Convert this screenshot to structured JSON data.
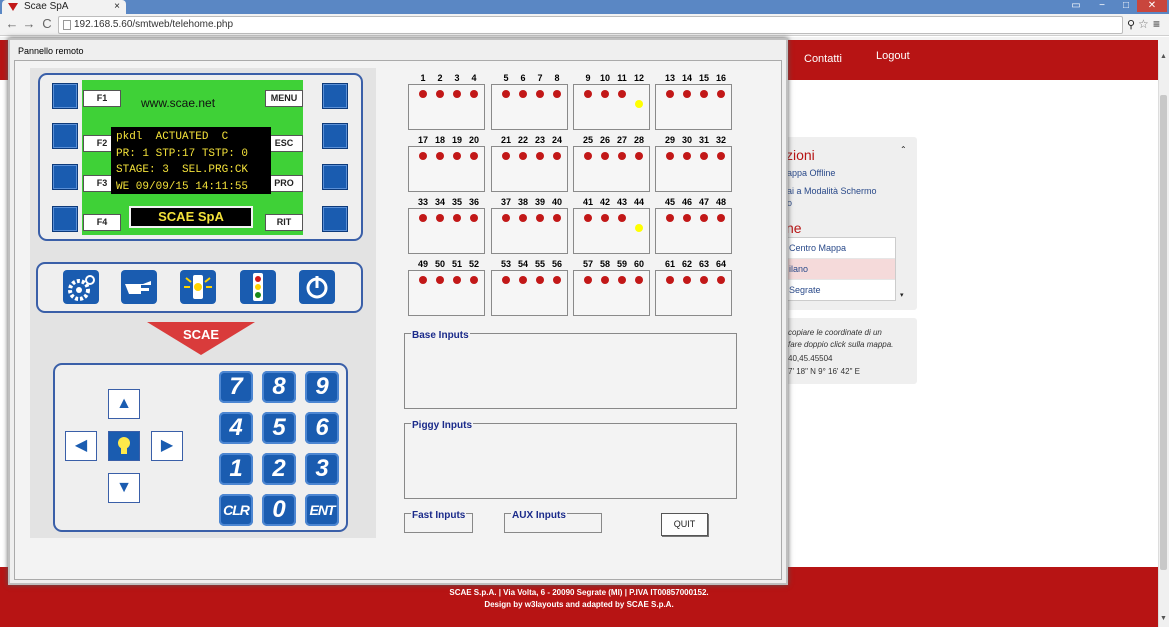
{
  "browser": {
    "tab_title": "Scae SpA",
    "tab_close": "×",
    "url": "192.168.5.60/smtweb/telehome.php",
    "nav": {
      "back": "←",
      "forward": "→",
      "reload": "C"
    },
    "window_controls": {
      "restore": "▭",
      "minimize": "−",
      "maximize": "□",
      "close": "✕"
    }
  },
  "website": {
    "nav_links": [
      "Contatti",
      "Logout"
    ],
    "sidebar": {
      "section_title": "zioni",
      "items": [
        "appa Offline",
        "ai a Modalità Schermo",
        "o"
      ],
      "map_title": "ne",
      "map_items": [
        "Centro Mappa",
        "ilano",
        "Segrate"
      ],
      "hint_lines": [
        "copiare le coordinate di un",
        "fare doppio click sulla mappa."
      ],
      "coords": [
        "40,45.45504",
        "7' 18\" N 9° 16' 42\" E"
      ]
    },
    "footer": {
      "line1": "SCAE S.p.A. | Via Volta, 6 - 20090 Segrate (MI) | P.IVA IT00857000152.",
      "line2": "Design by w3layouts and adapted by SCAE S.p.A."
    }
  },
  "dialog": {
    "title": "Pannello remoto",
    "device": {
      "lcd_url": "www.scae.net",
      "lcd_lines": [
        "pkdl  ACTUATED  C",
        "PR: 1 STP:17 TSTP: 0",
        "STAGE: 3  SEL.PRG:CK",
        "WE 09/09/15 14:11:55"
      ],
      "brand": "SCAE SpA",
      "left_keys": [
        "F1",
        "F2",
        "F3",
        "F4"
      ],
      "right_keys": [
        "MENU",
        "ESC",
        "PRO",
        "RIT"
      ],
      "function_icons": [
        "settings-icon",
        "hand-pointer-icon",
        "traffic-light-flash-icon",
        "traffic-light-icon",
        "power-icon"
      ],
      "logo_text": "SCAE",
      "numpad": [
        [
          "7",
          "8",
          "9"
        ],
        [
          "4",
          "5",
          "6"
        ],
        [
          "1",
          "2",
          "3"
        ],
        [
          "CLR",
          "0",
          "ENT"
        ]
      ],
      "arrows": {
        "up": "▲",
        "down": "▼",
        "left": "◀",
        "right": "▶",
        "center": "lamp"
      }
    },
    "io_groups": [
      {
        "labels": [
          "1",
          "2",
          "3",
          "4"
        ],
        "leds": [
          "red",
          "red",
          "red",
          "red",
          "off",
          "off",
          "off",
          "off"
        ]
      },
      {
        "labels": [
          "5",
          "6",
          "7",
          "8"
        ],
        "leds": [
          "red",
          "red",
          "red",
          "red",
          "off",
          "off",
          "off",
          "off"
        ]
      },
      {
        "labels": [
          "9",
          "10",
          "11",
          "12"
        ],
        "leds": [
          "red",
          "red",
          "red",
          "off",
          "off",
          "off",
          "off",
          "yellow"
        ]
      },
      {
        "labels": [
          "13",
          "14",
          "15",
          "16"
        ],
        "leds": [
          "red",
          "red",
          "red",
          "red",
          "off",
          "off",
          "off",
          "off"
        ]
      },
      {
        "labels": [
          "17",
          "18",
          "19",
          "20"
        ],
        "leds": [
          "red",
          "red",
          "red",
          "red",
          "off",
          "off",
          "off",
          "off"
        ]
      },
      {
        "labels": [
          "21",
          "22",
          "23",
          "24"
        ],
        "leds": [
          "red",
          "red",
          "red",
          "red",
          "off",
          "off",
          "off",
          "off"
        ]
      },
      {
        "labels": [
          "25",
          "26",
          "27",
          "28"
        ],
        "leds": [
          "red",
          "red",
          "red",
          "red",
          "off",
          "off",
          "off",
          "off"
        ]
      },
      {
        "labels": [
          "29",
          "30",
          "31",
          "32"
        ],
        "leds": [
          "red",
          "red",
          "red",
          "red",
          "off",
          "off",
          "off",
          "off"
        ]
      },
      {
        "labels": [
          "33",
          "34",
          "35",
          "36"
        ],
        "leds": [
          "red",
          "red",
          "red",
          "red",
          "off",
          "off",
          "off",
          "off"
        ]
      },
      {
        "labels": [
          "37",
          "38",
          "39",
          "40"
        ],
        "leds": [
          "red",
          "red",
          "red",
          "red",
          "off",
          "off",
          "off",
          "off"
        ]
      },
      {
        "labels": [
          "41",
          "42",
          "43",
          "44"
        ],
        "leds": [
          "red",
          "red",
          "red",
          "off",
          "off",
          "off",
          "off",
          "yellow"
        ]
      },
      {
        "labels": [
          "45",
          "46",
          "47",
          "48"
        ],
        "leds": [
          "red",
          "red",
          "red",
          "red",
          "off",
          "off",
          "off",
          "off"
        ]
      },
      {
        "labels": [
          "49",
          "50",
          "51",
          "52"
        ],
        "leds": [
          "red",
          "red",
          "red",
          "red",
          "off",
          "off",
          "off",
          "off"
        ]
      },
      {
        "labels": [
          "53",
          "54",
          "55",
          "56"
        ],
        "leds": [
          "red",
          "red",
          "red",
          "red",
          "off",
          "off",
          "off",
          "off"
        ]
      },
      {
        "labels": [
          "57",
          "58",
          "59",
          "60"
        ],
        "leds": [
          "red",
          "red",
          "red",
          "red",
          "off",
          "off",
          "off",
          "off"
        ]
      },
      {
        "labels": [
          "61",
          "62",
          "63",
          "64"
        ],
        "leds": [
          "red",
          "red",
          "red",
          "red",
          "off",
          "off",
          "off",
          "off"
        ]
      }
    ],
    "base_inputs": "Base Inputs",
    "piggy_inputs": "Piggy Inputs",
    "fast_inputs": "Fast Inputs",
    "aux_inputs": "AUX Inputs",
    "quit": "QUIT"
  },
  "colors": {
    "brand_red": "#b71414",
    "key_blue": "#1a5cb0",
    "lcd_green": "#3fd137",
    "lcd_text": "#f3e13a",
    "led_red": "#c21818",
    "led_yellow": "#ffff00"
  }
}
